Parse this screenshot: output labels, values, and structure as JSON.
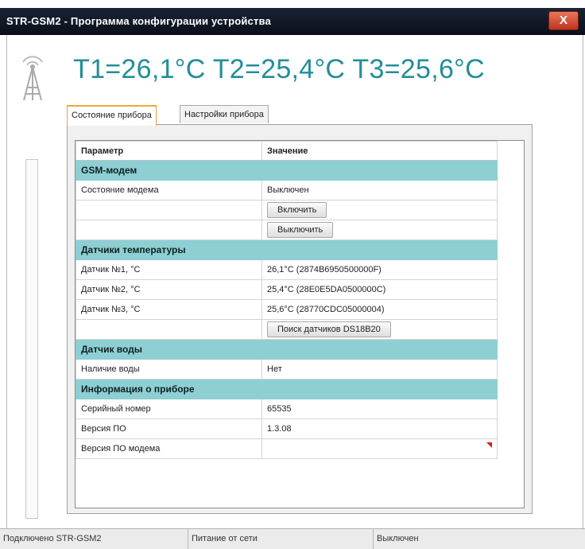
{
  "window": {
    "title": "STR-GSM2 - Программа конфигурации устройства",
    "close_label": "X"
  },
  "temperature_heading": "T1=26,1°C T2=25,4°C T3=25,6°C",
  "tabs": [
    {
      "label": "Состояние прибора",
      "active": true
    },
    {
      "label": "Настройки прибора",
      "active": false
    }
  ],
  "grid": {
    "headers": [
      "Параметр",
      "Значение"
    ],
    "rows": [
      {
        "type": "group",
        "label": "GSM-модем"
      },
      {
        "type": "row",
        "param": "Состояние модема",
        "value": "Выключен"
      },
      {
        "type": "button",
        "value": "Включить"
      },
      {
        "type": "button",
        "value": "Выключить"
      },
      {
        "type": "group",
        "label": "Датчики температуры"
      },
      {
        "type": "row",
        "param": "Датчик №1, °C",
        "value": "26,1°C (2874B6950500000F)"
      },
      {
        "type": "row",
        "param": "Датчик №2, °C",
        "value": "25,4°C (28E0E5DA0500000C)"
      },
      {
        "type": "row",
        "param": "Датчик №3, °C",
        "value": "25,6°C (28770CDC05000004)"
      },
      {
        "type": "button",
        "value": "Поиск датчиков DS18B20"
      },
      {
        "type": "group",
        "label": "Датчик воды"
      },
      {
        "type": "row",
        "param": "Наличие воды",
        "value": "Нет"
      },
      {
        "type": "group",
        "label": "Информация о приборе"
      },
      {
        "type": "row",
        "param": "Серийный номер",
        "value": "65535"
      },
      {
        "type": "row",
        "param": "Версия ПО",
        "value": "1.3.08"
      },
      {
        "type": "row",
        "param": "Версия ПО модема",
        "value": "",
        "marker": true
      }
    ]
  },
  "statusbar": [
    "Подключено STR-GSM2",
    "Питание от сети",
    "Выключен"
  ],
  "colors": {
    "accent_text": "#238e98",
    "group_row": "#8dcfd3",
    "active_tab": "#f0a838",
    "close_button": "#c0341c"
  }
}
